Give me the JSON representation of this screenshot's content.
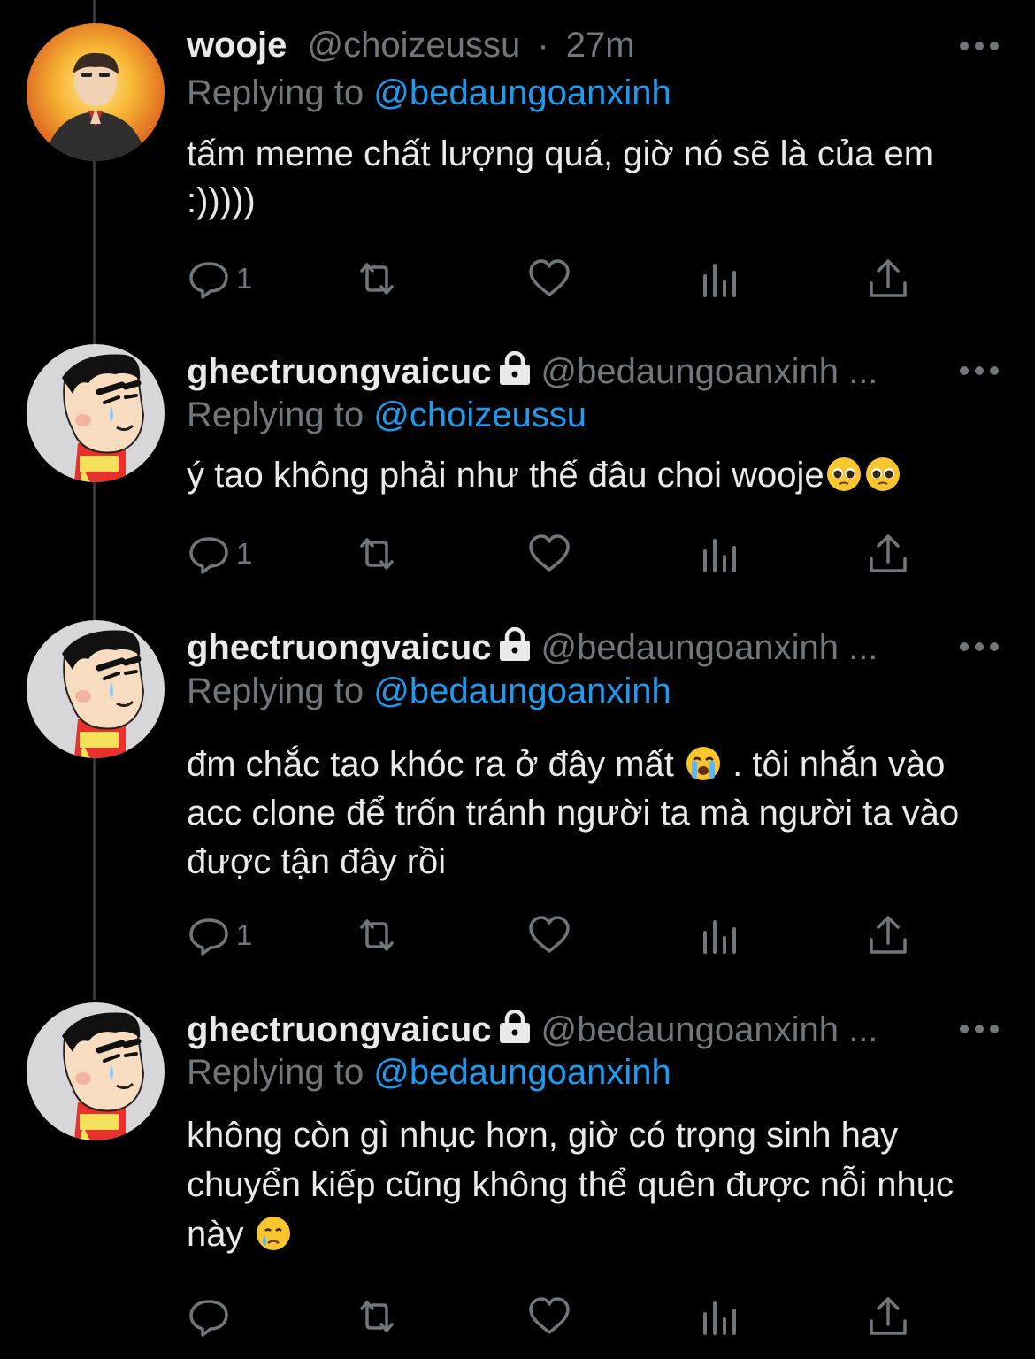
{
  "colors": {
    "background": "#000000",
    "text": "#e7e9ea",
    "muted": "#71767b",
    "mention": "#1d9bf0",
    "thread_line": "#333639"
  },
  "tweets": [
    {
      "display_name": "wooje",
      "protected": false,
      "handle": "@choizeussu",
      "dot": "·",
      "time": "27m",
      "reply_prefix": "Replying to",
      "reply_to": "@bedaungoanxinh",
      "text": "tấm meme chất lượng quá, giờ nó sẽ là của em :)))))",
      "emojis": [],
      "reply_count": "1",
      "avatar": "photo-avatar-icon"
    },
    {
      "display_name": "ghectruongvaicuc",
      "protected": true,
      "handle": "@bedaungoanxinh ...",
      "reply_prefix": "Replying to",
      "reply_to": "@choizeussu",
      "text": "ý tao không phải như thế đâu choi wooje",
      "emojis": [
        "pleading-face-icon",
        "pleading-face-icon"
      ],
      "reply_count": "1",
      "avatar": "cartoon-avatar-icon"
    },
    {
      "display_name": "ghectruongvaicuc",
      "protected": true,
      "handle": "@bedaungoanxinh ...",
      "reply_prefix": "Replying to",
      "reply_to": "@bedaungoanxinh",
      "text_before_emoji": "đm chắc tao khóc ra ở đây mất ",
      "text_after_emoji": " . tôi nhắn vào acc clone để trốn tránh người ta mà người ta vào được tận đây rồi",
      "emojis": [
        "loudly-crying-face-icon"
      ],
      "reply_count": "1",
      "avatar": "cartoon-avatar-icon"
    },
    {
      "display_name": "ghectruongvaicuc",
      "protected": true,
      "handle": "@bedaungoanxinh ...",
      "reply_prefix": "Replying to",
      "reply_to": "@bedaungoanxinh",
      "text": "không còn gì nhục hơn, giờ có trọng sinh hay chuyển kiếp cũng không thể quên được nỗi nhục này ",
      "emojis": [
        "crying-face-icon"
      ],
      "reply_count": "",
      "avatar": "cartoon-avatar-icon"
    }
  ],
  "action_icons": [
    "reply-icon",
    "retweet-icon",
    "like-icon",
    "views-icon",
    "share-icon"
  ]
}
